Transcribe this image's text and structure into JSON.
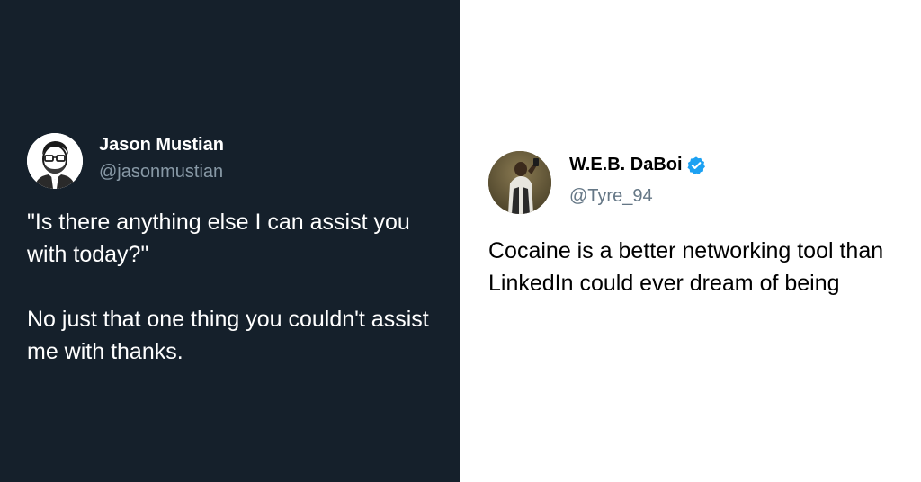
{
  "left_tweet": {
    "display_name": "Jason Mustian",
    "handle": "@jasonmustian",
    "text_line1": "\"Is there anything else I can assist you with today?\"",
    "text_line2": "No just that one thing you couldn't assist me with thanks.",
    "avatar_icon": "cartoon-man-portrait",
    "background_color": "#15202b",
    "text_color": "#ffffff",
    "handle_color": "#8899a6"
  },
  "right_tweet": {
    "display_name": "W.E.B. DaBoi",
    "verified": true,
    "verified_icon": "verified-badge-icon",
    "handle": "@Tyre_94",
    "text": "Cocaine is a better networking tool than LinkedIn could ever dream of being",
    "avatar_icon": "selfie-photo",
    "background_color": "#ffffff",
    "text_color": "#000000",
    "handle_color": "#657786",
    "verified_color": "#1da1f2"
  }
}
